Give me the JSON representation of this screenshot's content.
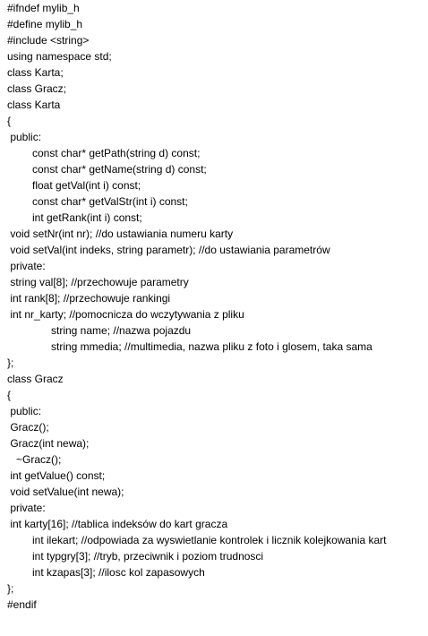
{
  "document": {
    "lines": [
      "#ifndef mylib_h",
      "#define mylib_h",
      "#include <string>",
      "using namespace std;",
      "class Karta;",
      "class Gracz;",
      "class Karta",
      "{",
      " public:",
      "const char* getPath(string d) const;",
      "const char* getName(string d) const;",
      "float getVal(int i) const;",
      "const char* getValStr(int i) const;",
      "int getRank(int i) const;",
      " void setNr(int nr); //do ustawiania numeru karty",
      " void setVal(int indeks, string parametr); //do ustawiania parametrów",
      " private:",
      " string val[8]; //przechowuje parametry",
      " int rank[8]; //przechowuje rankingi",
      " int nr_karty; //pomocnicza do wczytywania z pliku",
      "string name; //nazwa pojazdu",
      "string mmedia; //multimedia, nazwa pliku z foto i glosem, taka sama",
      "};",
      "class Gracz",
      "{",
      " public:",
      " Gracz();",
      " Gracz(int newa);",
      "~Gracz();",
      " int getValue() const;",
      " void setValue(int newa);",
      " private:",
      " int karty[16]; //tablica indeksów do kart gracza",
      "int ilekart; //odpowiada za wyswietlanie kontrolek i licznik kolejkowania kart",
      "int typgry[3]; //tryb, przeciwnik i poziom trudnosci",
      "int kzapas[3]; //ilosc kol zapasowych",
      "};",
      "#endif"
    ]
  }
}
